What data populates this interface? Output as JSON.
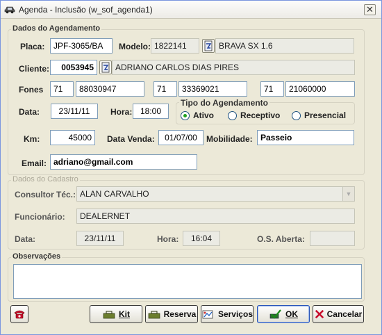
{
  "window": {
    "title": "Agenda - Inclusão (w_sof_agenda1)"
  },
  "groups": {
    "agendamento": "Dados do Agendamento",
    "tipo": "Tipo do Agendamento",
    "cadastro": "Dados do Cadastro",
    "observacoes": "Observações"
  },
  "labels": {
    "placa": "Placa:",
    "modelo": "Modelo:",
    "cliente": "Cliente:",
    "fones": "Fones",
    "data": "Data:",
    "hora": "Hora:",
    "km": "Km:",
    "data_venda": "Data Venda:",
    "mobilidade": "Mobilidade:",
    "email": "Email:",
    "consultor": "Consultor Téc.:",
    "funcionario": "Funcionário:",
    "cad_data": "Data:",
    "cad_hora": "Hora:",
    "os_aberta": "O.S. Aberta:"
  },
  "fields": {
    "placa": "JPF-3065/BA",
    "modelo_code": "1822141",
    "modelo_desc": "BRAVA SX 1.6",
    "cliente_code": "0053945",
    "cliente_name": "ADRIANO CARLOS DIAS PIRES",
    "fone1_ddd": "71",
    "fone1_num": "88030947",
    "fone2_ddd": "71",
    "fone2_num": "33369021",
    "fone3_ddd": "71",
    "fone3_num": "21060000",
    "data": "23/11/11",
    "hora": "18:00",
    "km": "45000",
    "data_venda": "01/07/00",
    "mobilidade": "Passeio",
    "email": "adriano@gmail.com",
    "consultor": "ALAN CARVALHO",
    "funcionario": "DEALERNET",
    "cad_data": "23/11/11",
    "cad_hora": "16:04",
    "os_aberta": "",
    "observacoes": ""
  },
  "tipo_options": [
    {
      "label": "Ativo",
      "selected": true
    },
    {
      "label": "Receptivo",
      "selected": false
    },
    {
      "label": "Presencial",
      "selected": false
    }
  ],
  "buttons": {
    "kit": "Kit",
    "reserva": "Reserva",
    "servicos": "Serviços",
    "ok": "OK",
    "cancelar": "Cancelar"
  },
  "icons": {
    "title": "car-icon",
    "phone": "telephone-icon",
    "lookup": "lookup-icon"
  },
  "colors": {
    "window_bg": "#ece9d8",
    "field_border": "#7f9db9",
    "radio_dot": "#21a121",
    "cancel_x": "#c8102e"
  }
}
